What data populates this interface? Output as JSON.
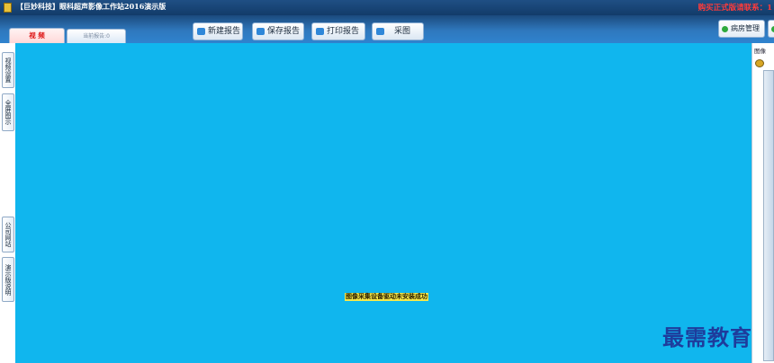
{
  "window": {
    "title": "【巨妙科技】眼科超声影像工作站2016演示版",
    "purchase_notice": "购买正式版请联系：1"
  },
  "tabs": [
    {
      "label": "视 频"
    },
    {
      "label": "当前报告:0"
    }
  ],
  "toolbar": {
    "new_report": "新建报告",
    "save_report": "保存报告",
    "print_report": "打印报告",
    "capture": "采图"
  },
  "right_toolbar": {
    "ward_management": "病房管理"
  },
  "left_tabs": [
    {
      "label": "视频设置"
    },
    {
      "label": "全屏图示"
    },
    {
      "label": "公司网站"
    },
    {
      "label": "演示版说明"
    }
  ],
  "viewport": {
    "background_color": "#10b6ee",
    "status_message": "图像采集设备驱动未安装成功"
  },
  "right_panel": {
    "header": "图像"
  },
  "watermark": {
    "text": "最需教育"
  }
}
